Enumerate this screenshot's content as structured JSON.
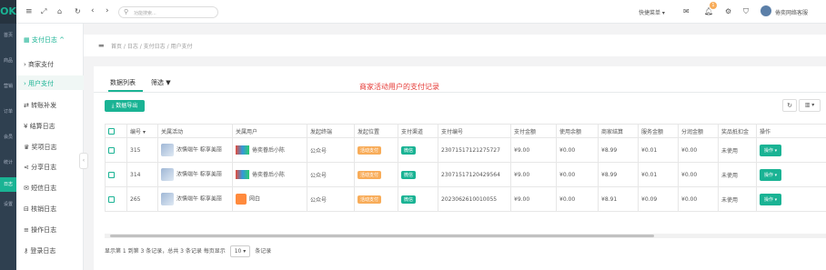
{
  "rail": {
    "logo": "OK",
    "items": [
      "首页",
      "商品",
      "营销",
      "订单",
      "会员",
      "统计",
      "日志",
      "设置"
    ]
  },
  "topbar": {
    "search_placeholder": "功能搜索...",
    "quick_menu": "快捷菜单 ▾",
    "notif_count": "1",
    "user": "倦奕网络客服"
  },
  "sidebar": {
    "group": "支付日志 ^",
    "items": [
      "商家支付",
      "用户支付",
      "转账补发",
      "结算日志",
      "奖项日志",
      "分享日志",
      "短信日志",
      "核销日志",
      "操作日志",
      "登录日志"
    ]
  },
  "breadcrumb": "首页 / 日志 / 支付日志 / 用户支付",
  "tabs": {
    "data": "数据列表",
    "filter": "筛选"
  },
  "annotation": "商家活动用户的支付记录",
  "export_label": "数据导出",
  "table": {
    "headers": [
      "编号",
      "关属活动",
      "关属用户",
      "发起终端",
      "发起位置",
      "支付渠道",
      "支付编号",
      "支付金额",
      "使用余额",
      "商家结算",
      "服务金额",
      "分润金额",
      "奖品抵扣金",
      "操作"
    ],
    "rows": [
      {
        "id": "315",
        "activity": "浓情端午 粽享美丽",
        "user": "倦奕眷后小陈",
        "terminal": "公众号",
        "position": "活动支付",
        "channel": "微信",
        "pay_no": "23071517121275727",
        "amount": "¥9.00",
        "balance": "¥0.00",
        "settle": "¥8.99",
        "service": "¥0.01",
        "share": "¥0.00",
        "prize": "未使用",
        "op": "操作 ▾"
      },
      {
        "id": "314",
        "activity": "浓情端午 粽享美丽",
        "user": "倦奕眷后小陈",
        "terminal": "公众号",
        "position": "活动支付",
        "channel": "微信",
        "pay_no": "23071517120429564",
        "amount": "¥9.00",
        "balance": "¥0.00",
        "settle": "¥8.99",
        "service": "¥0.01",
        "share": "¥0.00",
        "prize": "未使用",
        "op": "操作 ▾"
      },
      {
        "id": "265",
        "activity": "浓情端午 粽享美丽",
        "user": "网白",
        "terminal": "公众号",
        "position": "活动支付",
        "channel": "微信",
        "pay_no": "2023062610010055",
        "amount": "¥9.00",
        "balance": "¥0.00",
        "settle": "¥8.91",
        "service": "¥0.09",
        "share": "¥0.00",
        "prize": "未使用",
        "op": "操作 ▾"
      }
    ]
  },
  "pagination": {
    "summary": "显示第 1 到第 3 条记录，总共 3 条记录 每页显示",
    "page_size": "10 ▾",
    "suffix": "条记录"
  },
  "colors": {
    "accent": "#1ab394",
    "orange": "#f8ac59",
    "rail": "#2f4050",
    "annotation": "#e53935"
  }
}
